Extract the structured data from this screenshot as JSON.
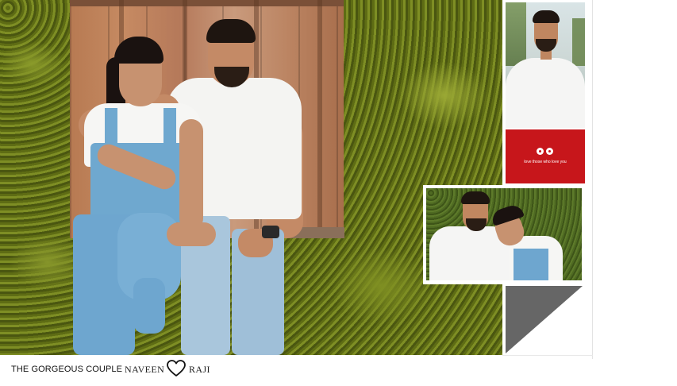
{
  "caption": {
    "title": "THE GORGEOUS COUPLE",
    "name_left": "NAVEEN",
    "name_right": "RAJI"
  },
  "red_tile": {
    "text": "love those who love you",
    "background": "#c7161b"
  },
  "icons": {
    "heart": "heart-outline-icon",
    "eyes": "cartoon-eyes-icon"
  },
  "colors": {
    "accent_red": "#c7161b",
    "triangle_gray": "#666666",
    "ivy_green": "#5f6d18"
  }
}
